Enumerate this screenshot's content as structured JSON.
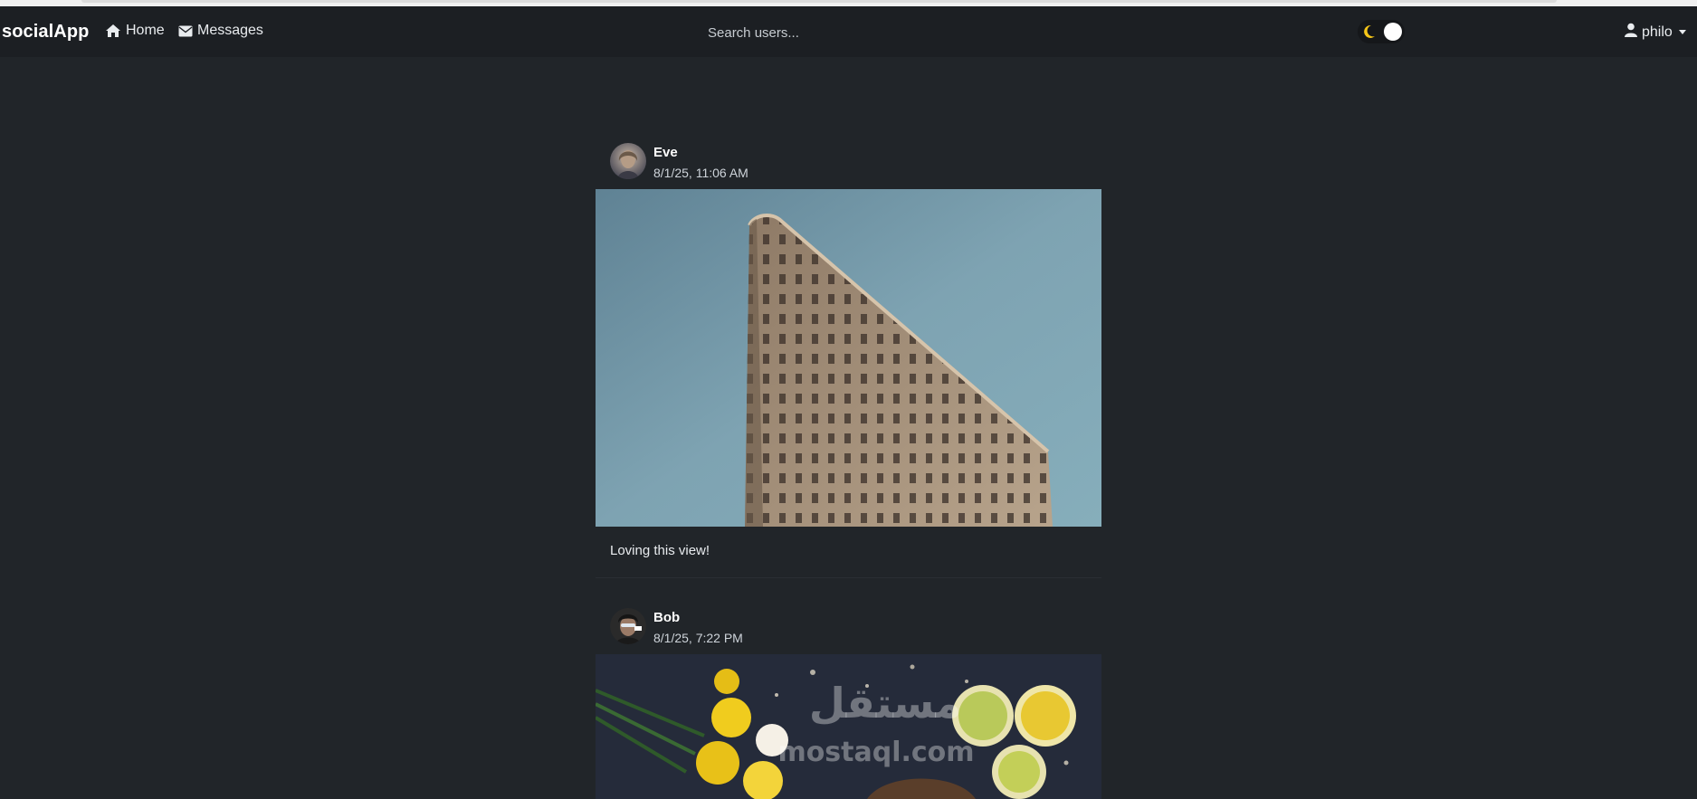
{
  "navbar": {
    "brand": "socialApp",
    "home_label": "Home",
    "messages_label": "Messages",
    "search_placeholder": "Search users...",
    "theme_icon": "moon-icon",
    "user_label": "philo"
  },
  "posts": [
    {
      "author": "Eve",
      "timestamp": "8/1/25, 11:06 AM",
      "caption": "Loving this view!"
    },
    {
      "author": "Bob",
      "timestamp": "8/1/25, 7:22 PM",
      "watermark_text": "mostaql.com"
    }
  ],
  "colors": {
    "background": "#212529",
    "navbar": "#1c1f23",
    "accent_moon": "#f5c518"
  }
}
